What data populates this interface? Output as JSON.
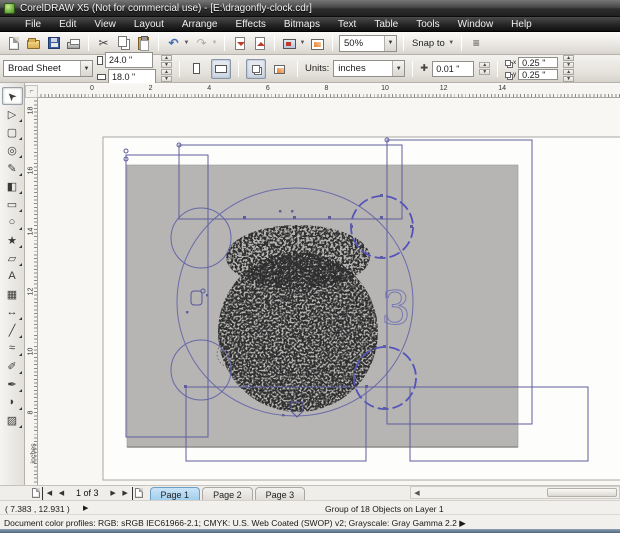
{
  "window": {
    "title": "CorelDRAW X5 (Not for commercial use) - [E:\\dragonfly-clock.cdr]"
  },
  "menu": {
    "items": [
      "File",
      "Edit",
      "View",
      "Layout",
      "Arrange",
      "Effects",
      "Bitmaps",
      "Text",
      "Table",
      "Tools",
      "Window",
      "Help"
    ]
  },
  "toolbar": {
    "zoom_value": "50%",
    "snap_label": "Snap to",
    "glyphs": {
      "cut": "✂",
      "undo": "↶",
      "redo": "↷",
      "dropdown": "▼",
      "options": "≡"
    }
  },
  "propbar": {
    "preset": "Broad Sheet",
    "width_value": "24.0 \"",
    "height_value": "18.0 \"",
    "units_label": "Units:",
    "units_value": "inches",
    "nudge_icon": "✚",
    "nudge_value": "0.01 \"",
    "dup_x_label": "x",
    "dup_y_label": "y",
    "dup_x": "0.25 \"",
    "dup_y": "0.25 \""
  },
  "toolbox": {
    "tools": [
      {
        "name": "pick-tool",
        "glyph": "➤",
        "selected": true,
        "flyout": false,
        "rotate": true
      },
      {
        "name": "shape-tool",
        "glyph": "▷",
        "selected": false,
        "flyout": true,
        "rotate": false
      },
      {
        "name": "crop-tool",
        "glyph": "▢",
        "selected": false,
        "flyout": true,
        "rotate": false
      },
      {
        "name": "zoom-tool",
        "glyph": "◎",
        "selected": false,
        "flyout": true,
        "rotate": false
      },
      {
        "name": "freehand-tool",
        "glyph": "✎",
        "selected": false,
        "flyout": true,
        "rotate": false
      },
      {
        "name": "smart-fill-tool",
        "glyph": "◧",
        "selected": false,
        "flyout": true,
        "rotate": false
      },
      {
        "name": "rectangle-tool",
        "glyph": "▭",
        "selected": false,
        "flyout": true,
        "rotate": false
      },
      {
        "name": "ellipse-tool",
        "glyph": "○",
        "selected": false,
        "flyout": true,
        "rotate": false
      },
      {
        "name": "polygon-tool",
        "glyph": "★",
        "selected": false,
        "flyout": true,
        "rotate": false
      },
      {
        "name": "basic-shapes-tool",
        "glyph": "▱",
        "selected": false,
        "flyout": true,
        "rotate": false
      },
      {
        "name": "text-tool",
        "glyph": "A",
        "selected": false,
        "flyout": false,
        "rotate": false
      },
      {
        "name": "table-tool",
        "glyph": "▦",
        "selected": false,
        "flyout": false,
        "rotate": false
      },
      {
        "name": "dimension-tool",
        "glyph": "↔",
        "selected": false,
        "flyout": true,
        "rotate": false
      },
      {
        "name": "connector-tool",
        "glyph": "╱",
        "selected": false,
        "flyout": true,
        "rotate": false
      },
      {
        "name": "blend-tool",
        "glyph": "≈",
        "selected": false,
        "flyout": true,
        "rotate": false
      },
      {
        "name": "eyedropper-tool",
        "glyph": "✐",
        "selected": false,
        "flyout": true,
        "rotate": false
      },
      {
        "name": "outline-pen-tool",
        "glyph": "✒",
        "selected": false,
        "flyout": true,
        "rotate": false
      },
      {
        "name": "fill-tool",
        "glyph": "◗",
        "selected": false,
        "flyout": true,
        "rotate": false
      },
      {
        "name": "interactive-fill-tool",
        "glyph": "▨",
        "selected": false,
        "flyout": true,
        "rotate": false
      }
    ]
  },
  "rulers": {
    "h_numbers": [
      "0",
      "2",
      "4",
      "6",
      "8",
      "10",
      "12",
      "14"
    ],
    "v_numbers": [
      "18",
      "16",
      "14",
      "12",
      "10",
      "8"
    ],
    "unit": "inches"
  },
  "navigator": {
    "indicator": "1 of 3",
    "first": "◀",
    "prev": "◀",
    "next": "▶",
    "last": "▶",
    "tabs": [
      "Page 1",
      "Page 2",
      "Page 3"
    ],
    "active_index": 0
  },
  "status": {
    "coords": "( 7.383 , 12.931 )",
    "expand_icon": "▶",
    "object_info": "Group of 18 Objects on Layer 1",
    "profiles": "Document color profiles: RGB: sRGB IEC61966-2.1; CMYK: U.S. Web Coated (SWOP) v2; Grayscale: Gray Gamma 2.2 ▶"
  },
  "canvas": {
    "numeral": "3"
  },
  "colors": {
    "wire": "#5e5e9d",
    "wire_bold": "#5353bb",
    "bitmap_gray": "#b6b5b3",
    "active_tab": "#abd3ee",
    "sketch": "#3b3b3b"
  }
}
